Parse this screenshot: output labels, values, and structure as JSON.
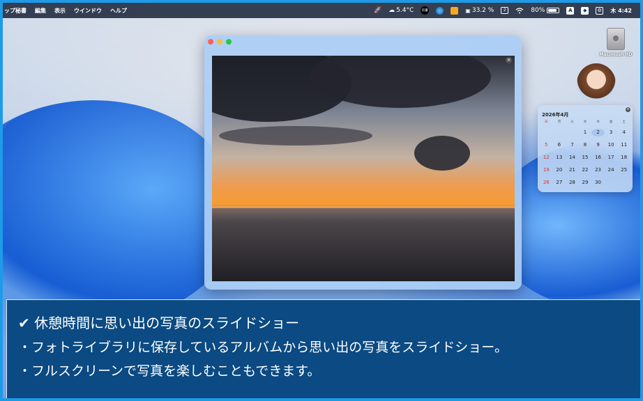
{
  "menubar": {
    "app_name": "ップ秘書",
    "items": [
      "編集",
      "表示",
      "ウインドウ",
      "ヘルプ"
    ],
    "weather": "5.4°C",
    "badge_text": "伝書",
    "cpu": "33.2 %",
    "calendar_day": "2",
    "battery": "80%",
    "battery_level": 0.8,
    "input_mode": "A",
    "clock": "木 4:42"
  },
  "desktop": {
    "drive_label": "Macintosh HD"
  },
  "window": {
    "close_color": "#ff5f57",
    "minimize_color": "#febc2e",
    "zoom_color": "#28c840"
  },
  "calendar": {
    "title": "2026年4月",
    "weekdays": [
      "日",
      "月",
      "火",
      "水",
      "木",
      "金",
      "土"
    ],
    "days": [
      "",
      "",
      "",
      "1",
      "2",
      "3",
      "4",
      "5",
      "6",
      "7",
      "8",
      "9",
      "10",
      "11",
      "12",
      "13",
      "14",
      "15",
      "16",
      "17",
      "18",
      "19",
      "20",
      "21",
      "22",
      "23",
      "24",
      "25",
      "26",
      "27",
      "28",
      "29",
      "30"
    ],
    "today": "2"
  },
  "caption": {
    "line1": "✔ 休憩時間に思い出の写真のスライドショー",
    "line2": "・フォトライブラリに保存しているアルバムから思い出の写真をスライドショー。",
    "line3": "・フルスクリーンで写真を楽しむこともできます。"
  }
}
